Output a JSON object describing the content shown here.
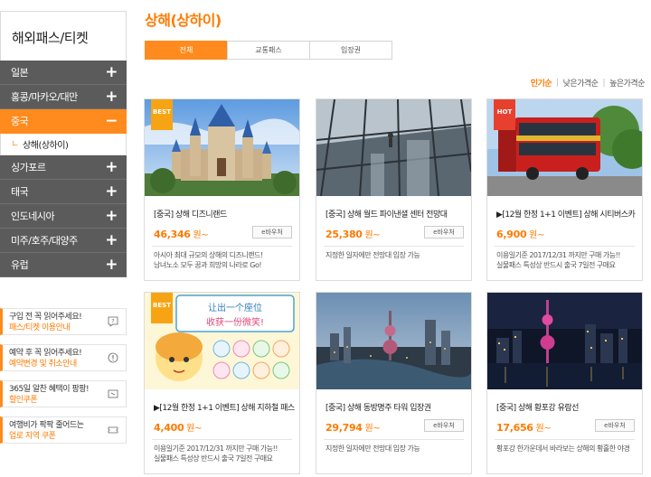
{
  "sidebar": {
    "title": "해외패스/티켓",
    "categories_top": [
      {
        "label": "일본",
        "toggle": "+"
      },
      {
        "label": "홍콩/마카오/대만",
        "toggle": "+"
      }
    ],
    "active_category": {
      "label": "중국",
      "toggle": "−"
    },
    "subcategory": {
      "label": "상해(상하이)"
    },
    "categories_bottom": [
      {
        "label": "싱가포르",
        "toggle": "+"
      },
      {
        "label": "태국",
        "toggle": "+"
      },
      {
        "label": "인도네시아",
        "toggle": "+"
      },
      {
        "label": "미주/호주/대양주",
        "toggle": "+"
      },
      {
        "label": "유럽",
        "toggle": "+"
      }
    ],
    "notices": [
      {
        "line1": "구입 전 꼭 읽어주세요!",
        "line2": "패스/티켓 이용안내"
      },
      {
        "line1": "예약 후 꼭 읽어주세요!",
        "line2": "예약변경 및 취소안내"
      },
      {
        "line1": "365일 알찬 혜택이 팡팡!",
        "line2": "할인쿠폰"
      },
      {
        "line1": "여행비가 팍팍 줄어드는",
        "line2": "업로 지역 쿠폰"
      }
    ]
  },
  "main": {
    "title": "상해(상하이)",
    "tabs": [
      "전체",
      "교통패스",
      "입장권"
    ],
    "sort": [
      "인기순",
      "낮은가격순",
      "높은가격순"
    ]
  },
  "products": [
    {
      "badge": "BEST",
      "name": "[중국] 상해 디즈니랜드",
      "price": "46,346",
      "unit": " 원~",
      "tag": "e바우처",
      "desc": [
        "아시아 최대 규모의 상해의 디즈니랜드!",
        "남녀노소 모두 꿈과 희망의 나라로 Go!"
      ]
    },
    {
      "badge": "",
      "name": "[중국] 상해 월드 파이낸셜 센터 전망대",
      "price": "25,380",
      "unit": " 원~",
      "tag": "e바우처",
      "desc": [
        "지정한 일자에만 전망대 입장 가능"
      ]
    },
    {
      "badge": "HOT",
      "name": "▶[12월 한정 1+1 이벤트] 상해 시티버스카",
      "price": "6,900",
      "unit": " 원~",
      "tag": "",
      "desc": [
        "이용일기준 2017/12/31 까지만 구매 가능!!",
        "실물패스 특성상 반드시 출국 7일전 구매요"
      ]
    },
    {
      "badge": "BEST",
      "name": "▶[12월 한정 1+1 이벤트] 상해 지하철 패스",
      "price": "4,400",
      "unit": " 원~",
      "tag": "",
      "desc": [
        "이용일기준 2017/12/31 까지만 구매 가능!!",
        "실물패스 특성상 반드시 출국 7일전 구매요"
      ]
    },
    {
      "badge": "",
      "name": "[중국] 상해 동방명주 타워 입장권",
      "price": "29,794",
      "unit": " 원~",
      "tag": "e바우처",
      "desc": [
        "지정한 일자에만 전망대 입장 가능"
      ]
    },
    {
      "badge": "",
      "name": "[중국] 상해 황포강 유람선",
      "price": "17,656",
      "unit": " 원~",
      "tag": "e바우처",
      "desc": [
        "황포강 한가운데서 바라보는 상해의 황홀한 야경"
      ]
    }
  ],
  "thumb_text": {
    "line1": "让出一个座位",
    "line2": "收获一份微笑!"
  },
  "colors": {
    "accent": "#ff8a1d",
    "dark_menu": "#5b5b5b",
    "hot": "#e8402e",
    "best": "#f6a414"
  }
}
